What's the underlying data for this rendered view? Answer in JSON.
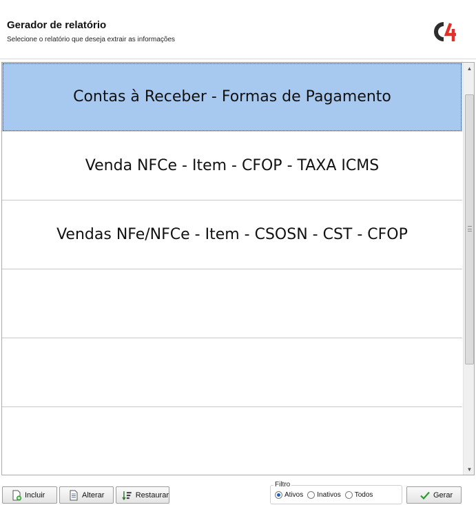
{
  "header": {
    "title": "Gerador de relatório",
    "subtitle": "Selecione o relatório que deseja extrair as informações",
    "logo_text": "C4"
  },
  "report_list": {
    "selected_index": 0,
    "items": [
      {
        "label": "Contas à Receber - Formas de Pagamento"
      },
      {
        "label": "Venda NFCe - Item - CFOP - TAXA ICMS"
      },
      {
        "label": "Vendas NFe/NFCe - Item - CSOSN - CST - CFOP"
      },
      {
        "label": ""
      },
      {
        "label": ""
      },
      {
        "label": ""
      }
    ]
  },
  "toolbar": {
    "incluir_label": "Incluir",
    "alterar_label": "Alterar",
    "restaurar_label": "Restaurar",
    "gerar_label": "Gerar"
  },
  "filter": {
    "label": "Filtro",
    "options": [
      {
        "label": "Ativos",
        "checked": true
      },
      {
        "label": "Inativos",
        "checked": false
      },
      {
        "label": "Todos",
        "checked": false
      }
    ]
  },
  "colors": {
    "selected_row": "#a7c8ef",
    "logo_dark": "#2d2d2d",
    "logo_red": "#e0302a",
    "gerar_check": "#2c9a2c"
  }
}
